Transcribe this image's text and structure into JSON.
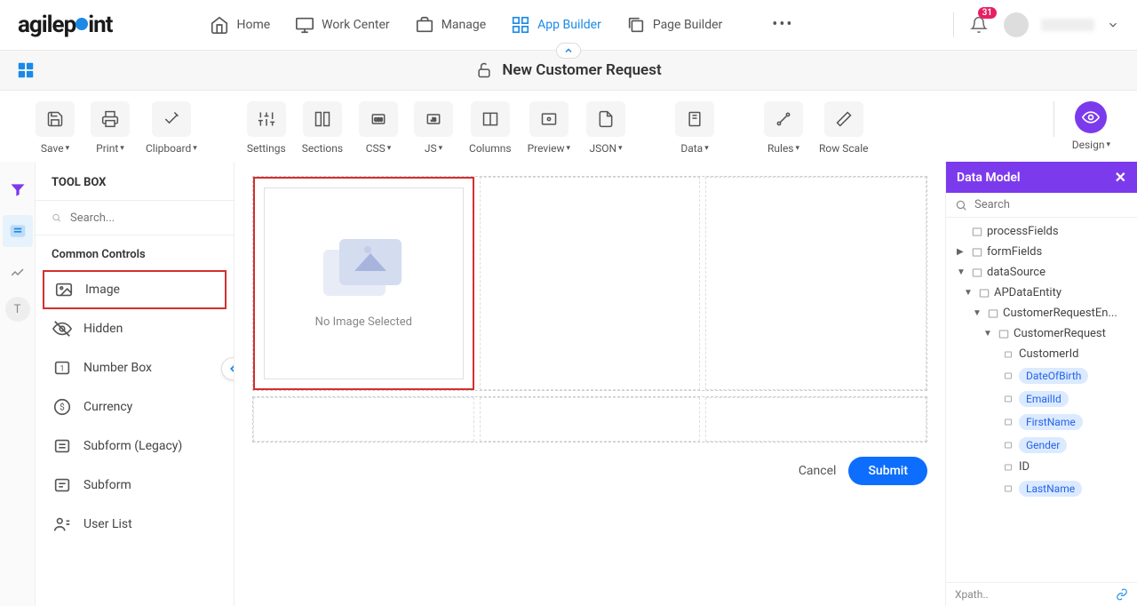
{
  "header": {
    "logo_pre": "agilep",
    "logo_post": "int",
    "nav": [
      {
        "label": "Home",
        "active": false
      },
      {
        "label": "Work Center",
        "active": false
      },
      {
        "label": "Manage",
        "active": false
      },
      {
        "label": "App Builder",
        "active": true
      },
      {
        "label": "Page Builder",
        "active": false
      }
    ],
    "notification_count": "31"
  },
  "subheader": {
    "title": "New Customer Request"
  },
  "toolbar": [
    {
      "label": "Save",
      "chev": true
    },
    {
      "label": "Print",
      "chev": true
    },
    {
      "label": "Clipboard",
      "chev": true
    },
    {
      "label": "Settings",
      "chev": false
    },
    {
      "label": "Sections",
      "chev": false
    },
    {
      "label": "CSS",
      "chev": true
    },
    {
      "label": "JS",
      "chev": true
    },
    {
      "label": "Columns",
      "chev": false
    },
    {
      "label": "Preview",
      "chev": true
    },
    {
      "label": "JSON",
      "chev": true
    },
    {
      "label": "Data",
      "chev": true
    },
    {
      "label": "Rules",
      "chev": true
    },
    {
      "label": "Row Scale",
      "chev": false
    }
  ],
  "toolbar_right": {
    "label": "Design",
    "chev": true
  },
  "toolbox": {
    "title": "TOOL BOX",
    "search_placeholder": "Search...",
    "section": "Common Controls",
    "items": [
      {
        "label": "Image",
        "highlighted": true,
        "icon": "image"
      },
      {
        "label": "Hidden",
        "highlighted": false,
        "icon": "hidden"
      },
      {
        "label": "Number Box",
        "highlighted": false,
        "icon": "number"
      },
      {
        "label": "Currency",
        "highlighted": false,
        "icon": "currency"
      },
      {
        "label": "Subform (Legacy)",
        "highlighted": false,
        "icon": "subform"
      },
      {
        "label": "Subform",
        "highlighted": false,
        "icon": "subform"
      },
      {
        "label": "User List",
        "highlighted": false,
        "icon": "userlist"
      }
    ]
  },
  "canvas": {
    "placeholder_text": "No Image Selected",
    "cancel": "Cancel",
    "submit": "Submit"
  },
  "data_model": {
    "title": "Data Model",
    "search_placeholder": "Search",
    "xpath_label": "Xpath..",
    "tree": {
      "processFields": {
        "label": "processFields",
        "expanded": false
      },
      "formFields": {
        "label": "formFields",
        "expanded": false
      },
      "dataSource": {
        "label": "dataSource",
        "expanded": true,
        "children": {
          "ap": {
            "label": "APDataEntity",
            "expanded": true,
            "children": {
              "cr": {
                "label": "CustomerRequestEn...",
                "expanded": true,
                "children": {
                  "crq": {
                    "label": "CustomerRequest",
                    "expanded": true,
                    "fields": [
                      {
                        "label": "CustomerId",
                        "highlighted": false
                      },
                      {
                        "label": "DateOfBirth",
                        "highlighted": true
                      },
                      {
                        "label": "EmailId",
                        "highlighted": true
                      },
                      {
                        "label": "FirstName",
                        "highlighted": true
                      },
                      {
                        "label": "Gender",
                        "highlighted": true
                      },
                      {
                        "label": "ID",
                        "highlighted": false
                      },
                      {
                        "label": "LastName",
                        "highlighted": true
                      }
                    ]
                  }
                }
              }
            }
          }
        }
      }
    }
  }
}
